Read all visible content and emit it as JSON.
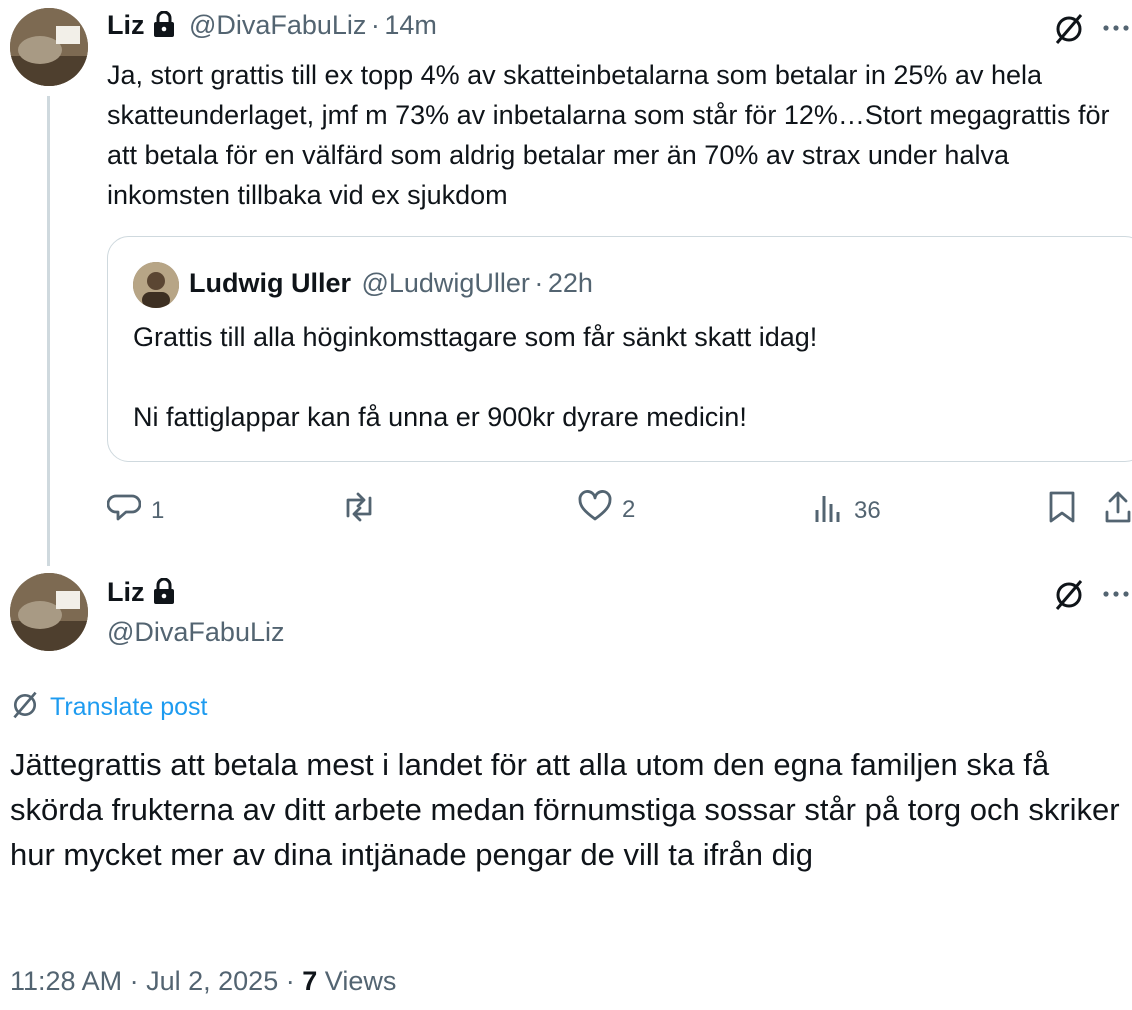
{
  "reply_post": {
    "author_name": "Liz",
    "handle": "@DivaFabuLiz",
    "separator": "·",
    "time": "14m",
    "text": "Ja, stort grattis till ex topp 4% av skatteinbetalarna som betalar in 25% av hela skatteunderlaget, jmf m 73% av inbetalarna som står för 12%…Stort megagrattis för att betala för en välfärd som aldrig betalar mer än 70% av strax under halva inkomsten tillbaka vid ex sjukdom",
    "quoted": {
      "author_name": "Ludwig Uller",
      "handle": "@LudwigUller",
      "separator": "·",
      "time": "22h",
      "line1": "Grattis till alla höginkomsttagare som får sänkt skatt idag!",
      "line2": "Ni fattiglappar kan få unna er 900kr dyrare medicin!"
    },
    "actions": {
      "replies": "1",
      "reposts": "",
      "likes": "2",
      "views": "36"
    }
  },
  "main_post": {
    "author_name": "Liz",
    "handle": "@DivaFabuLiz",
    "translate_label": "Translate post",
    "text": "Jättegrattis att betala mest i landet för att alla utom den egna familjen ska få skörda frukterna av ditt arbete medan förnumstiga sossar står på torg och skriker hur mycket mer av dina intjänade pengar de vill ta ifrån dig",
    "timestamp": "11:28 AM",
    "date": "Jul 2, 2025",
    "separator": "·",
    "views_count": "7",
    "views_label": "Views"
  },
  "icons": [
    "lock-icon",
    "translate-icon",
    "more-icon",
    "reply-icon",
    "repost-icon",
    "like-icon",
    "views-icon",
    "bookmark-icon",
    "share-icon"
  ],
  "colors": {
    "link": "#1d9bf0",
    "secondary": "#536471",
    "border": "#cfd9de"
  }
}
